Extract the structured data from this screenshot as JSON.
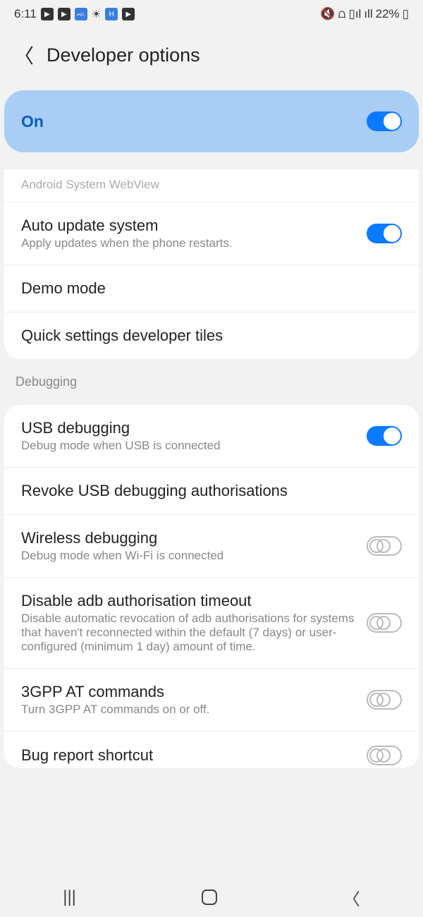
{
  "status": {
    "time": "6:11",
    "battery": "22%"
  },
  "header": {
    "title": "Developer options"
  },
  "master": {
    "label": "On",
    "on": true
  },
  "faded_item": "Android System WebView",
  "section1": [
    {
      "title": "Auto update system",
      "sub": "Apply updates when the phone restarts.",
      "toggle": true,
      "on": true
    },
    {
      "title": "Demo mode",
      "sub": "",
      "toggle": false
    },
    {
      "title": "Quick settings developer tiles",
      "sub": "",
      "toggle": false
    }
  ],
  "section_debug_label": "Debugging",
  "section2": [
    {
      "title": "USB debugging",
      "sub": "Debug mode when USB is connected",
      "toggle": true,
      "on": true
    },
    {
      "title": "Revoke USB debugging authorisations",
      "sub": "",
      "toggle": false
    },
    {
      "title": "Wireless debugging",
      "sub": "Debug mode when Wi-Fi is connected",
      "toggle": true,
      "on": false
    },
    {
      "title": "Disable adb authorisation timeout",
      "sub": "Disable automatic revocation of adb authorisations for systems that haven't reconnected within the default (7 days) or user-configured (minimum 1 day) amount of time.",
      "toggle": true,
      "on": false
    },
    {
      "title": "3GPP AT commands",
      "sub": "Turn 3GPP AT commands on or off.",
      "toggle": true,
      "on": false
    },
    {
      "title": "Bug report shortcut",
      "sub": "",
      "toggle": true,
      "on": false,
      "partial": true
    }
  ]
}
